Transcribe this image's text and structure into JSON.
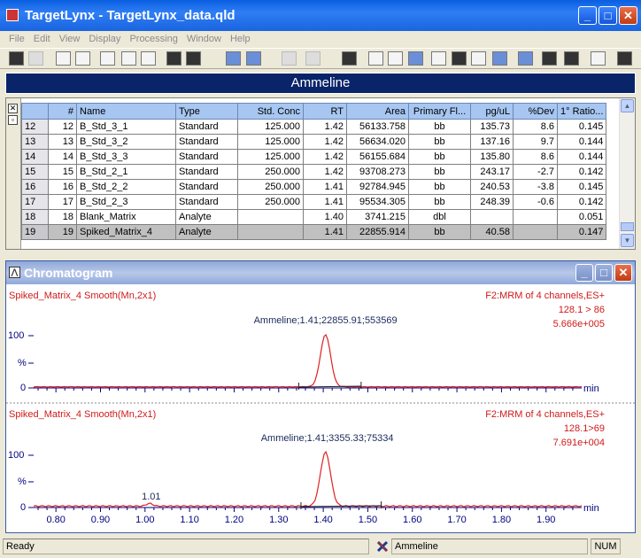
{
  "window": {
    "title": "TargetLynx - TargetLynx_data.qld"
  },
  "menu": [
    "File",
    "Edit",
    "View",
    "Display",
    "Processing",
    "Window",
    "Help"
  ],
  "toolbar_icons": [
    "open-icon",
    "save-icon",
    "peak-icon",
    "integrate-icon",
    "report-icon",
    "preview-icon",
    "print-preview-icon",
    "prev-sample-icon",
    "next-sample-icon",
    "prev-compound-icon",
    "next-compound-icon",
    "prev-group-icon",
    "next-group-icon",
    "expand-icon",
    "chromatogram-icon",
    "spectrum-icon",
    "calibration-icon",
    "table-icon",
    "summary-icon",
    "book-icon",
    "globe-icon",
    "method-icon",
    "rows-icon",
    "columns-icon",
    "printer-icon",
    "help-icon"
  ],
  "compound_title": "Ammeline",
  "table": {
    "columns": [
      "",
      "#",
      "Name",
      "Type",
      "Std. Conc",
      "RT",
      "Area",
      "Primary Fl...",
      "pg/uL",
      "%Dev",
      "1° Ratio..."
    ],
    "rows": [
      [
        "12",
        "12",
        "B_Std_3_1",
        "Standard",
        "125.000",
        "1.42",
        "56133.758",
        "bb",
        "135.73",
        "8.6",
        "0.145"
      ],
      [
        "13",
        "13",
        "B_Std_3_2",
        "Standard",
        "125.000",
        "1.42",
        "56634.020",
        "bb",
        "137.16",
        "9.7",
        "0.144"
      ],
      [
        "14",
        "14",
        "B_Std_3_3",
        "Standard",
        "125.000",
        "1.42",
        "56155.684",
        "bb",
        "135.80",
        "8.6",
        "0.144"
      ],
      [
        "15",
        "15",
        "B_Std_2_1",
        "Standard",
        "250.000",
        "1.42",
        "93708.273",
        "bb",
        "243.17",
        "-2.7",
        "0.142"
      ],
      [
        "16",
        "16",
        "B_Std_2_2",
        "Standard",
        "250.000",
        "1.41",
        "92784.945",
        "bb",
        "240.53",
        "-3.8",
        "0.145"
      ],
      [
        "17",
        "17",
        "B_Std_2_3",
        "Standard",
        "250.000",
        "1.41",
        "95534.305",
        "bb",
        "248.39",
        "-0.6",
        "0.142"
      ],
      [
        "18",
        "18",
        "Blank_Matrix",
        "Analyte",
        "",
        "1.40",
        "3741.215",
        "dbl",
        "",
        "",
        "0.051"
      ],
      [
        "19",
        "19",
        "Spiked_Matrix_4",
        "Analyte",
        "",
        "1.41",
        "22855.914",
        "bb",
        "40.58",
        "",
        "0.147"
      ]
    ],
    "selected_row": 7
  },
  "chromatogram": {
    "title": "Chromatogram",
    "traces": [
      {
        "sample": "Spiked_Matrix_4  Smooth(Mn,2x1)",
        "channel": "F2:MRM of 4 channels,ES+",
        "transition": "128.1 > 86",
        "intensity": "5.666e+005",
        "peak_label": "Ammeline;1.41;22855.91;553569",
        "y_top": "100",
        "y_unit": "%",
        "y_zero": "0",
        "x_unit": "min"
      },
      {
        "sample": "Spiked_Matrix_4  Smooth(Mn,2x1)",
        "channel": "F2:MRM of 4 channels,ES+",
        "transition": "128.1>69",
        "intensity": "7.691e+004",
        "peak_label": "Ammeline;1.41;3355.33;75334",
        "minor_label": "1.01",
        "y_top": "100",
        "y_unit": "%",
        "y_zero": "0",
        "x_unit": "min"
      }
    ],
    "x_ticks": [
      "0.80",
      "0.90",
      "1.00",
      "1.10",
      "1.20",
      "1.30",
      "1.40",
      "1.50",
      "1.60",
      "1.70",
      "1.80",
      "1.90"
    ],
    "x_range": [
      0.75,
      1.98
    ],
    "peak_rt": 1.405,
    "minor_rt": 1.01,
    "integration": {
      "start": 1.345,
      "end": 1.485,
      "start2": 1.35,
      "end2": 1.53
    }
  },
  "status": {
    "ready": "Ready",
    "compound": "Ammeline",
    "num": "NUM"
  },
  "colors": {
    "trace": "#e02020",
    "axis": "#000080",
    "header": "#a7c6f1",
    "selected": "#c0c0c0"
  }
}
